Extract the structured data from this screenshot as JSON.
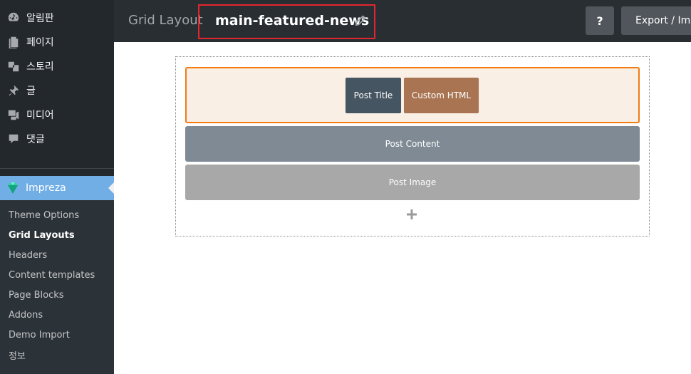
{
  "sidebar": {
    "menu": [
      {
        "label": "알림판",
        "icon": "dashboard-icon"
      },
      {
        "label": "페이지",
        "icon": "pages-icon"
      },
      {
        "label": "스토리",
        "icon": "stories-icon"
      },
      {
        "label": "글",
        "icon": "pushpin-icon"
      },
      {
        "label": "미디어",
        "icon": "media-icon"
      },
      {
        "label": "댓글",
        "icon": "comment-icon"
      }
    ],
    "active_menu": {
      "label": "Impreza",
      "icon": "impreza-diamond-icon",
      "color": "#72aee6"
    },
    "submenu": [
      {
        "label": "Theme Options"
      },
      {
        "label": "Grid Layouts",
        "current": true
      },
      {
        "label": "Headers"
      },
      {
        "label": "Content templates"
      },
      {
        "label": "Page Blocks"
      },
      {
        "label": "Addons"
      },
      {
        "label": "Demo Import"
      },
      {
        "label": "정보"
      }
    ]
  },
  "topbar": {
    "label": "Grid Layout",
    "title": "main-featured-news",
    "help_label": "?",
    "export_label": "Export / Import"
  },
  "builder": {
    "row1": {
      "highlight_color": "#f27b12",
      "elements": [
        {
          "label": "Post Title",
          "color": "#465562"
        },
        {
          "label": "Custom HTML",
          "color": "#a87452"
        }
      ]
    },
    "row2": {
      "label": "Post Content",
      "color": "#7f8a95"
    },
    "row3": {
      "label": "Post Image",
      "color": "#a8a8a8"
    },
    "add_icon": "plus-icon"
  }
}
